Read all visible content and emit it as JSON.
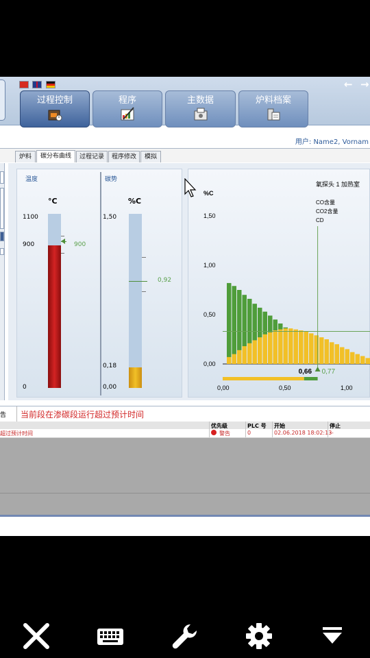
{
  "flags": [
    "cn-flag-icon",
    "uk-flag-icon",
    "de-flag-icon"
  ],
  "nav": {
    "back_arrow": "←",
    "forward_arrow": "→",
    "buttons": [
      {
        "label": "过程控制",
        "icon": "furnace-icon"
      },
      {
        "label": "程序",
        "icon": "program-edit-icon"
      },
      {
        "label": "主数据",
        "icon": "master-data-icon"
      },
      {
        "label": "炉料档案",
        "icon": "charge-archive-icon"
      }
    ]
  },
  "user": {
    "label": "用户: Name2, Vornam"
  },
  "tabs": [
    "炉料",
    "碳分布曲线",
    "过程记录",
    "程序修改",
    "模拟"
  ],
  "temperature": {
    "title": "温度",
    "unit": "°C",
    "ticks": [
      "1100",
      "900",
      "0"
    ],
    "value_label": "900",
    "max": 1100,
    "value": 900
  },
  "carbon": {
    "title": "碳势",
    "unit": "%C",
    "ticks": [
      "1,50",
      "0,18",
      "0,00"
    ],
    "value_label": "0,92",
    "max": 1.5,
    "value": 0.92,
    "fill_value": 0.18
  },
  "chart_data": {
    "type": "bar",
    "title": "氧探头 1 加热室",
    "ylabel": "%C",
    "ylim": [
      0,
      1.5
    ],
    "y_ticks": [
      "1,50",
      "1,00",
      "0,50",
      "0,00"
    ],
    "x_ticks": [
      "0,00",
      "0,50",
      "1,00"
    ],
    "xlim": [
      0,
      1.2
    ],
    "legend": [
      "CO含量",
      "CO2含量",
      "CD"
    ],
    "series": [
      {
        "name": "green",
        "color": "#4f9d3a",
        "values": [
          0.82,
          0.79,
          0.75,
          0.7,
          0.66,
          0.61,
          0.57,
          0.53,
          0.49,
          0.45,
          0.41,
          0.37,
          0.34,
          0.31,
          0.28,
          0.25,
          0.22,
          0.2,
          0.18,
          0.16,
          0.14,
          0.12,
          0.1,
          0.08,
          0.07,
          0.06,
          0.05,
          0.04
        ]
      },
      {
        "name": "yellow",
        "color": "#f2c027",
        "values": [
          0.07,
          0.1,
          0.14,
          0.18,
          0.21,
          0.24,
          0.27,
          0.3,
          0.32,
          0.34,
          0.35,
          0.36,
          0.36,
          0.35,
          0.34,
          0.33,
          0.31,
          0.29,
          0.27,
          0.25,
          0.22,
          0.2,
          0.17,
          0.15,
          0.12,
          0.1,
          0.08,
          0.06
        ]
      }
    ],
    "marker_value": 0.77,
    "marker_label": "0,77",
    "current_label": "0,66",
    "progress_yellow": 0.66,
    "progress_green": 0.77
  },
  "status": {
    "label": "告",
    "message": "当前段在渗碳段运行超过预计时间"
  },
  "alarms": {
    "headers": [
      "优先级",
      "PLC 号",
      "开始",
      "停止"
    ],
    "rows": [
      {
        "text": "超过预计时间",
        "priority": "警告",
        "plc": "0",
        "start": "02.06.2018 18:02:13",
        "stop": "--"
      }
    ]
  },
  "softkeys": [
    "close-icon",
    "keyboard-icon",
    "wrench-icon",
    "gear-icon",
    "dropdown-icon"
  ]
}
